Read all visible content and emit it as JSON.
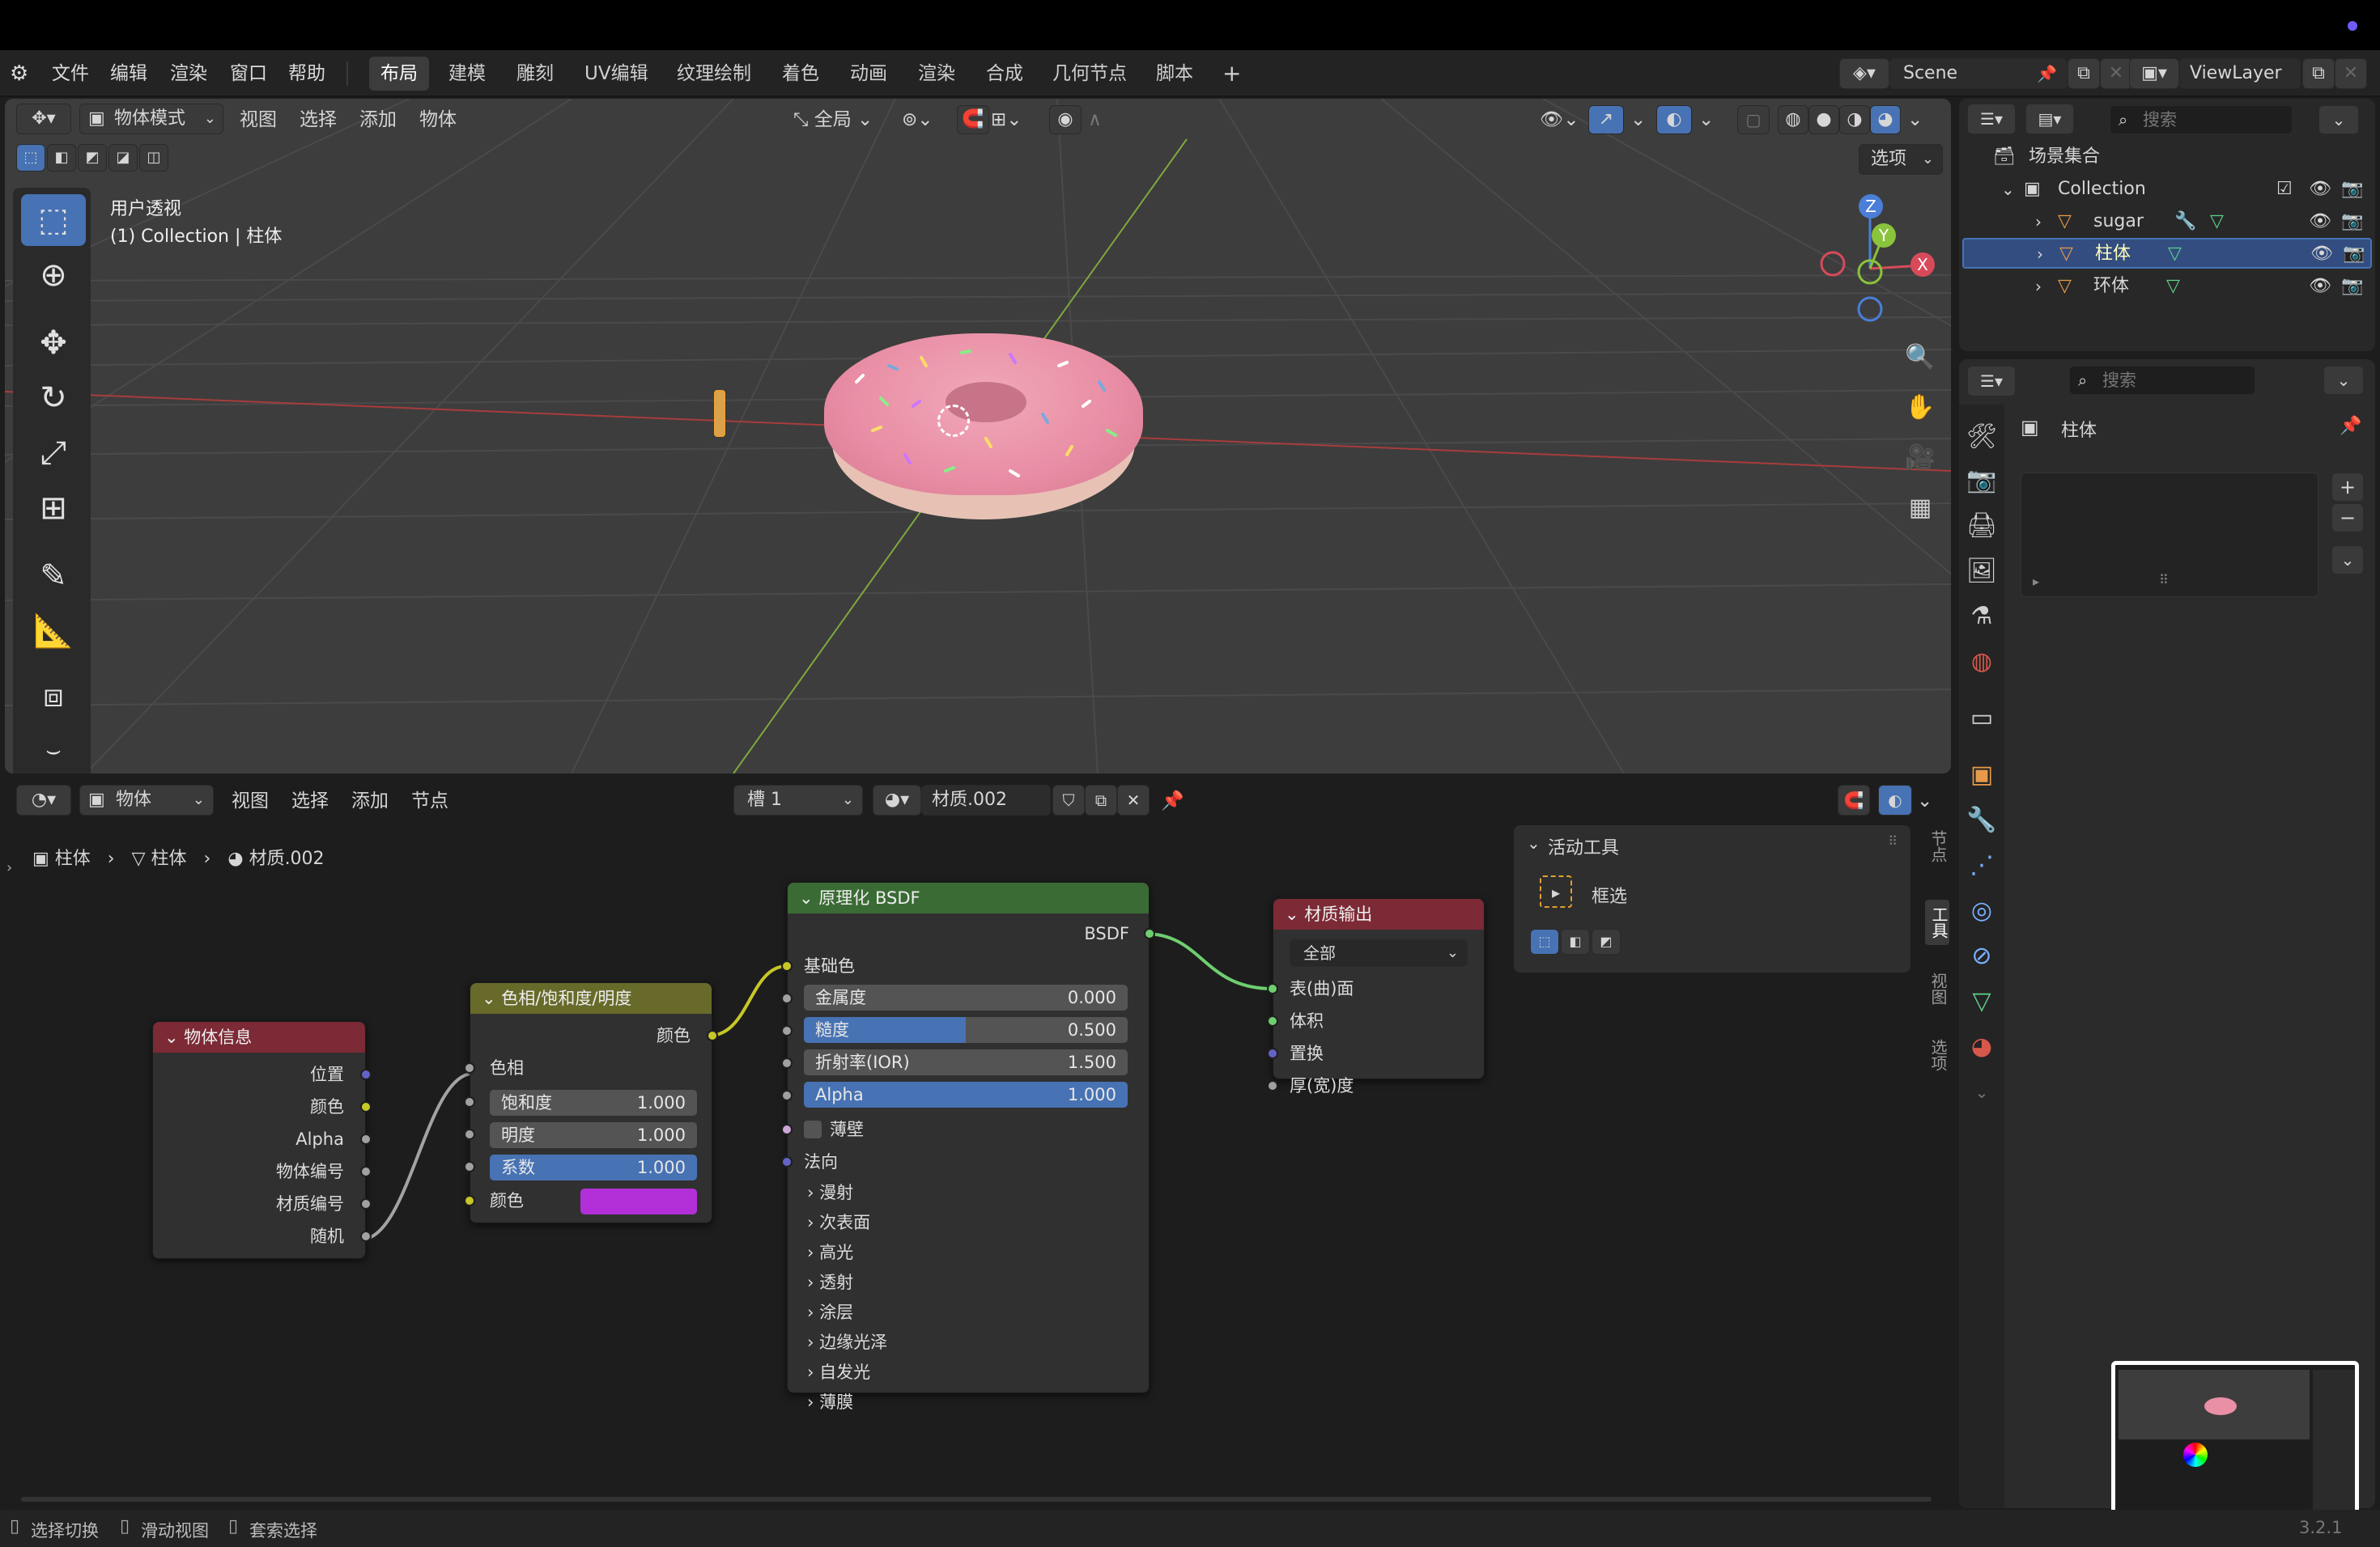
{
  "menu": {
    "items": [
      "文件",
      "编辑",
      "渲染",
      "窗口",
      "帮助"
    ],
    "workspaces": [
      "布局",
      "建模",
      "雕刻",
      "UV编辑",
      "纹理绘制",
      "着色",
      "动画",
      "渲染",
      "合成",
      "几何节点",
      "脚本"
    ],
    "add_tab": "+",
    "scene": "Scene",
    "view_layer": "ViewLayer"
  },
  "viewport": {
    "mode": "物体模式",
    "menus": [
      "视图",
      "选择",
      "添加",
      "物体"
    ],
    "transform": "全局",
    "options": "选项",
    "overlay_title": "用户透视",
    "overlay_sub": "(1) Collection | 柱体",
    "gizmo": {
      "x": "X",
      "y": "Y",
      "z": "Z"
    }
  },
  "outliner": {
    "search_placeholder": "搜索",
    "root": "场景集合",
    "collection": "Collection",
    "objects": [
      "sugar",
      "柱体",
      "环体"
    ]
  },
  "properties": {
    "search_placeholder": "搜索",
    "object_name": "柱体",
    "plus": "+",
    "minus": "−"
  },
  "node_editor": {
    "type": "物体",
    "menus": [
      "视图",
      "选择",
      "添加",
      "节点"
    ],
    "slot": "槽 1",
    "material": "材质.002",
    "breadcrumb": [
      "柱体",
      "柱体",
      "材质.002"
    ],
    "sidebar_tabs": [
      "节点",
      "工具",
      "视图",
      "选项"
    ],
    "active_tool_title": "活动工具",
    "active_tool_name": "框选"
  },
  "nodes": {
    "object_info": {
      "title": "物体信息",
      "outputs": [
        "位置",
        "颜色",
        "Alpha",
        "物体编号",
        "材质编号",
        "随机"
      ]
    },
    "hsv": {
      "title": "色相/饱和度/明度",
      "out": "颜色",
      "hue": "色相",
      "fields": [
        {
          "label": "饱和度",
          "value": "1.000"
        },
        {
          "label": "明度",
          "value": "1.000"
        },
        {
          "label": "系数",
          "value": "1.000",
          "fill": 1.0
        }
      ],
      "color_label": "颜色",
      "color": "#b22fd8"
    },
    "bsdf": {
      "title": "原理化 BSDF",
      "out": "BSDF",
      "base": "基础色",
      "fields": [
        {
          "label": "金属度",
          "value": "0.000",
          "fill": 0.0
        },
        {
          "label": "糙度",
          "value": "0.500",
          "fill": 0.5
        },
        {
          "label": "折射率(IOR)",
          "value": "1.500"
        },
        {
          "label": "Alpha",
          "value": "1.000",
          "fill": 1.0
        }
      ],
      "thin": "薄壁",
      "normal": "法向",
      "panels": [
        "漫射",
        "次表面",
        "高光",
        "透射",
        "涂层",
        "边缘光泽",
        "自发光",
        "薄膜"
      ]
    },
    "output": {
      "title": "材质输出",
      "target": "全部",
      "inputs": [
        "表(曲)面",
        "体积",
        "置换",
        "厚(宽)度"
      ]
    }
  },
  "status": {
    "items": [
      "选择切换",
      "滑动视图",
      "套索选择"
    ],
    "version": "3.2.1"
  },
  "colors": {
    "accent": "#4772b3",
    "bsdf_header": "#3a6b34",
    "shader_red": "#7c2a36",
    "converter": "#686a2a"
  }
}
